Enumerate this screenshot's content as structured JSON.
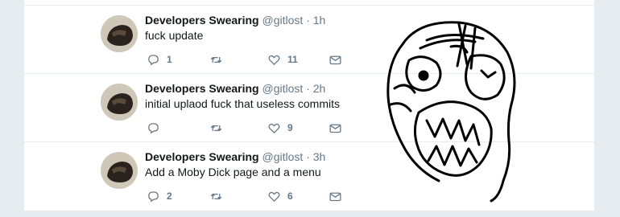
{
  "tweets": [
    {
      "name": "Developers Swearing",
      "meta": "@gitlost · 1h",
      "text": "fuck update",
      "replies": "1",
      "retweets": "",
      "likes": "11"
    },
    {
      "name": "Developers Swearing",
      "meta": "@gitlost · 2h",
      "text": "initial uplaod fuck that useless commits",
      "replies": "",
      "retweets": "",
      "likes": "9"
    },
    {
      "name": "Developers Swearing",
      "meta": "@gitlost · 3h",
      "text": "Add a Moby Dick page and a menu",
      "replies": "2",
      "retweets": "",
      "likes": "6"
    }
  ],
  "icons": {
    "reply": "reply-icon",
    "retweet": "retweet-icon",
    "like": "heart-icon",
    "dm": "envelope-icon"
  },
  "colors": {
    "background": "#e6ecf0",
    "card": "#ffffff",
    "text": "#14171a",
    "muted": "#657786"
  }
}
